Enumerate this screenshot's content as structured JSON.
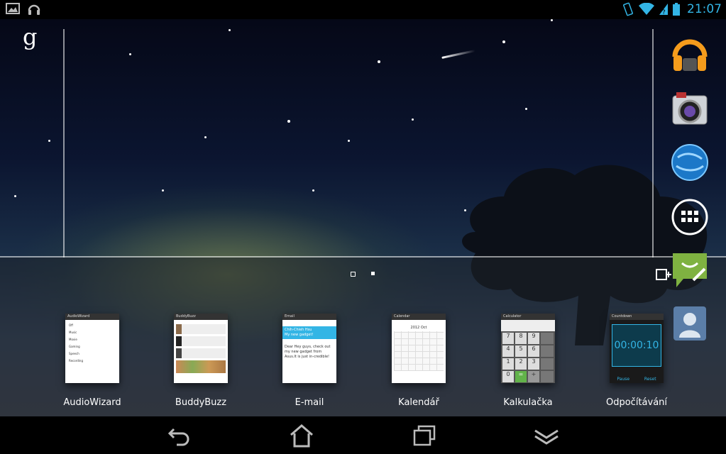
{
  "status_bar": {
    "time": "21:07",
    "left_icons": [
      "image-icon",
      "headphones-icon"
    ],
    "right_icons": [
      "vibrate-icon",
      "wifi-icon",
      "no-signal-icon",
      "battery-icon"
    ],
    "accent": "#33b5e5"
  },
  "home": {
    "search_logo": "g",
    "page_indicators": 2,
    "dock_icons": [
      "play-music-icon",
      "camera-icon",
      "browser-globe-icon",
      "app-drawer-icon",
      "messaging-icon",
      "contacts-icon"
    ]
  },
  "recent_apps": [
    {
      "label": "AudioWizard",
      "title": "AudioWizard",
      "items": [
        "Off",
        "Music",
        "Movie",
        "Gaming",
        "Speech",
        "Recording"
      ]
    },
    {
      "label": "BuddyBuzz",
      "title": "BuddyBuzz"
    },
    {
      "label": "E-mail",
      "title": "Email",
      "from": "Chih-Chieh Hsu",
      "subject": "My new gadget!",
      "body": "Dear Hey guys, check out my new gadget from Asus.It is just in-credible!"
    },
    {
      "label": "Kalendář",
      "title": "Calendar",
      "month": "2012 Oct"
    },
    {
      "label": "Kalkulačka",
      "title": "Calculator",
      "keys": [
        "7",
        "8",
        "9",
        "4",
        "5",
        "6",
        "1",
        "2",
        "3",
        "0",
        "=",
        "+"
      ]
    },
    {
      "label": "Odpočítávání",
      "title": "Countdown",
      "time": "00:00:10",
      "pause": "Pause",
      "reset": "Reset"
    }
  ],
  "nav_bar": {
    "buttons": [
      "back-icon",
      "home-icon",
      "recent-apps-icon",
      "menu-collapse-icon"
    ]
  }
}
